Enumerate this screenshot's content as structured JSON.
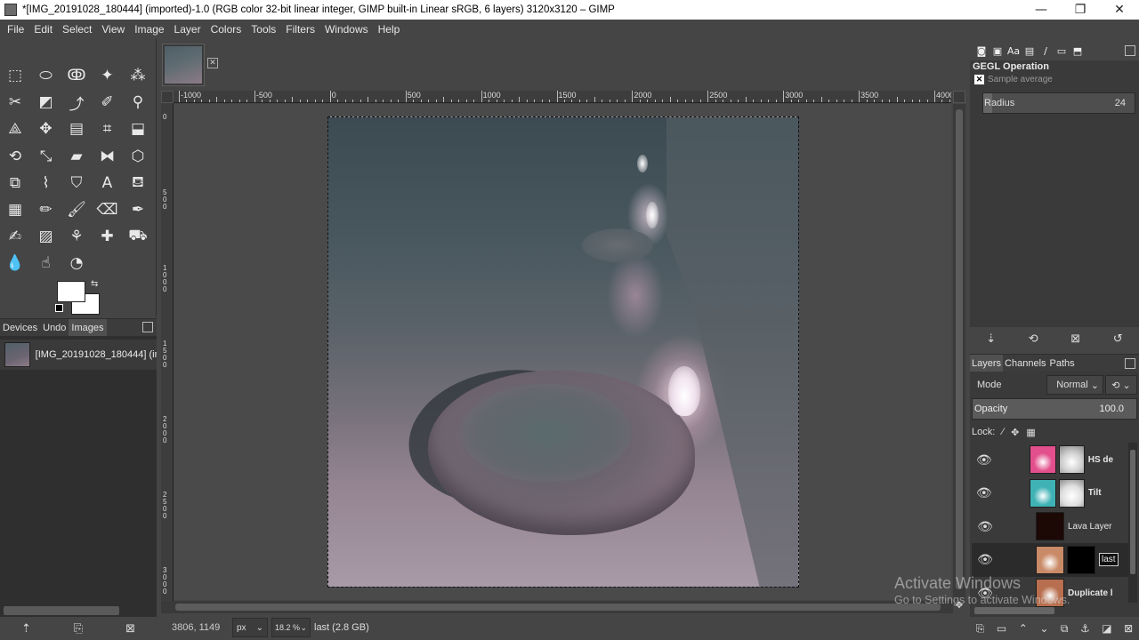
{
  "window": {
    "title": "*[IMG_20191028_180444] (imported)-1.0 (RGB color 32-bit linear integer, GIMP built-in Linear sRGB, 6 layers) 3120x3120 – GIMP",
    "controls": {
      "minimize": "—",
      "maximize": "❐",
      "close": "✕"
    }
  },
  "menu": [
    "File",
    "Edit",
    "Select",
    "View",
    "Image",
    "Layer",
    "Colors",
    "Tools",
    "Filters",
    "Windows",
    "Help"
  ],
  "toolbox": {
    "tools": [
      {
        "name": "rect-select-tool-icon",
        "glyph": "⬚"
      },
      {
        "name": "ellipse-select-tool-icon",
        "glyph": "⬭"
      },
      {
        "name": "free-select-tool-icon",
        "glyph": "ↂ"
      },
      {
        "name": "fuzzy-select-tool-icon",
        "glyph": "✦"
      },
      {
        "name": "select-by-color-tool-icon",
        "glyph": "⁂"
      },
      {
        "name": "scissors-select-tool-icon",
        "glyph": "✂"
      },
      {
        "name": "foreground-select-tool-icon",
        "glyph": "◩"
      },
      {
        "name": "paths-tool-icon",
        "glyph": "⤴"
      },
      {
        "name": "color-picker-tool-icon",
        "glyph": "✐"
      },
      {
        "name": "zoom-tool-icon",
        "glyph": "⚲"
      },
      {
        "name": "measure-tool-icon",
        "glyph": "⟁"
      },
      {
        "name": "move-tool-icon",
        "glyph": "✥"
      },
      {
        "name": "align-tool-icon",
        "glyph": "▤"
      },
      {
        "name": "crop-tool-icon",
        "glyph": "⌗"
      },
      {
        "name": "unified-transform-tool-icon",
        "glyph": "⬓"
      },
      {
        "name": "rotate-tool-icon",
        "glyph": "⟲"
      },
      {
        "name": "scale-tool-icon",
        "glyph": "⤡"
      },
      {
        "name": "shear-tool-icon",
        "glyph": "▰"
      },
      {
        "name": "flip-tool-icon",
        "glyph": "⧓"
      },
      {
        "name": "perspective-tool-icon",
        "glyph": "⬡"
      },
      {
        "name": "3d-transform-tool-icon",
        "glyph": "⧉"
      },
      {
        "name": "warp-transform-tool-icon",
        "glyph": "⌇"
      },
      {
        "name": "cage-transform-tool-icon",
        "glyph": "⛉"
      },
      {
        "name": "text-tool-icon",
        "glyph": "A"
      },
      {
        "name": "bucket-fill-tool-icon",
        "glyph": "⛾"
      },
      {
        "name": "gradient-tool-icon",
        "glyph": "▦"
      },
      {
        "name": "pencil-tool-icon",
        "glyph": "✏"
      },
      {
        "name": "paintbrush-tool-icon",
        "glyph": "🖌"
      },
      {
        "name": "eraser-tool-icon",
        "glyph": "⌫"
      },
      {
        "name": "airbrush-tool-icon",
        "glyph": "✒"
      },
      {
        "name": "ink-tool-icon",
        "glyph": "✍"
      },
      {
        "name": "mypaint-brush-tool-icon",
        "glyph": "▨"
      },
      {
        "name": "clone-tool-icon",
        "glyph": "⚘"
      },
      {
        "name": "heal-tool-icon",
        "glyph": "✚"
      },
      {
        "name": "perspective-clone-tool-icon",
        "glyph": "⛟"
      },
      {
        "name": "blur-sharpen-tool-icon",
        "glyph": "💧"
      },
      {
        "name": "smudge-tool-icon",
        "glyph": "☝"
      },
      {
        "name": "dodge-burn-tool-icon",
        "glyph": "◔"
      }
    ]
  },
  "left_dock": {
    "tabs": [
      "Devices",
      "Undo",
      "Images"
    ],
    "image_entry": "[IMG_20191028_180444] (im"
  },
  "canvas": {
    "ruler_h": [
      "-1000",
      "-500",
      "0",
      "500",
      "1000",
      "1500",
      "2000",
      "2500",
      "3000",
      "3500",
      "4000"
    ],
    "ruler_v": [
      "0",
      "500",
      "1000",
      "1500",
      "2000",
      "2500",
      "3000"
    ]
  },
  "statusbar": {
    "coords": "3806, 1149",
    "unit": "px",
    "zoom": "18.2 %",
    "message": "last (2.8 GB)"
  },
  "gegl": {
    "title": "GEGL Operation",
    "operation": "Sample average",
    "radius_label": "Radius",
    "radius_value": "24"
  },
  "layers_dock": {
    "tabs": [
      "Layers",
      "Channels",
      "Paths"
    ],
    "mode_label": "Mode",
    "mode_value": "Normal",
    "opacity_label": "Opacity",
    "opacity_value": "100.0",
    "lock_label": "Lock:",
    "layers": [
      {
        "name": "HS de",
        "visible": true,
        "thumb": "#e24f8c",
        "mask": "#cfcfcf",
        "bold": true
      },
      {
        "name": "Tilt",
        "visible": true,
        "thumb": "#3fb2b5",
        "mask": "#e0e0e0",
        "bold": true
      },
      {
        "name": "Lava Layer",
        "visible": true,
        "thumb": "#1c0805",
        "mask": "",
        "bold": false
      },
      {
        "name": "last",
        "visible": true,
        "thumb": "#c98a67",
        "mask": "#000000",
        "bold": false,
        "selected": true
      },
      {
        "name": "Duplicate la",
        "visible": true,
        "thumb": "#b86f4f",
        "mask": "",
        "bold": true
      }
    ]
  },
  "watermark": {
    "heading": "Activate Windows",
    "sub": "Go to Settings to activate Windows."
  }
}
